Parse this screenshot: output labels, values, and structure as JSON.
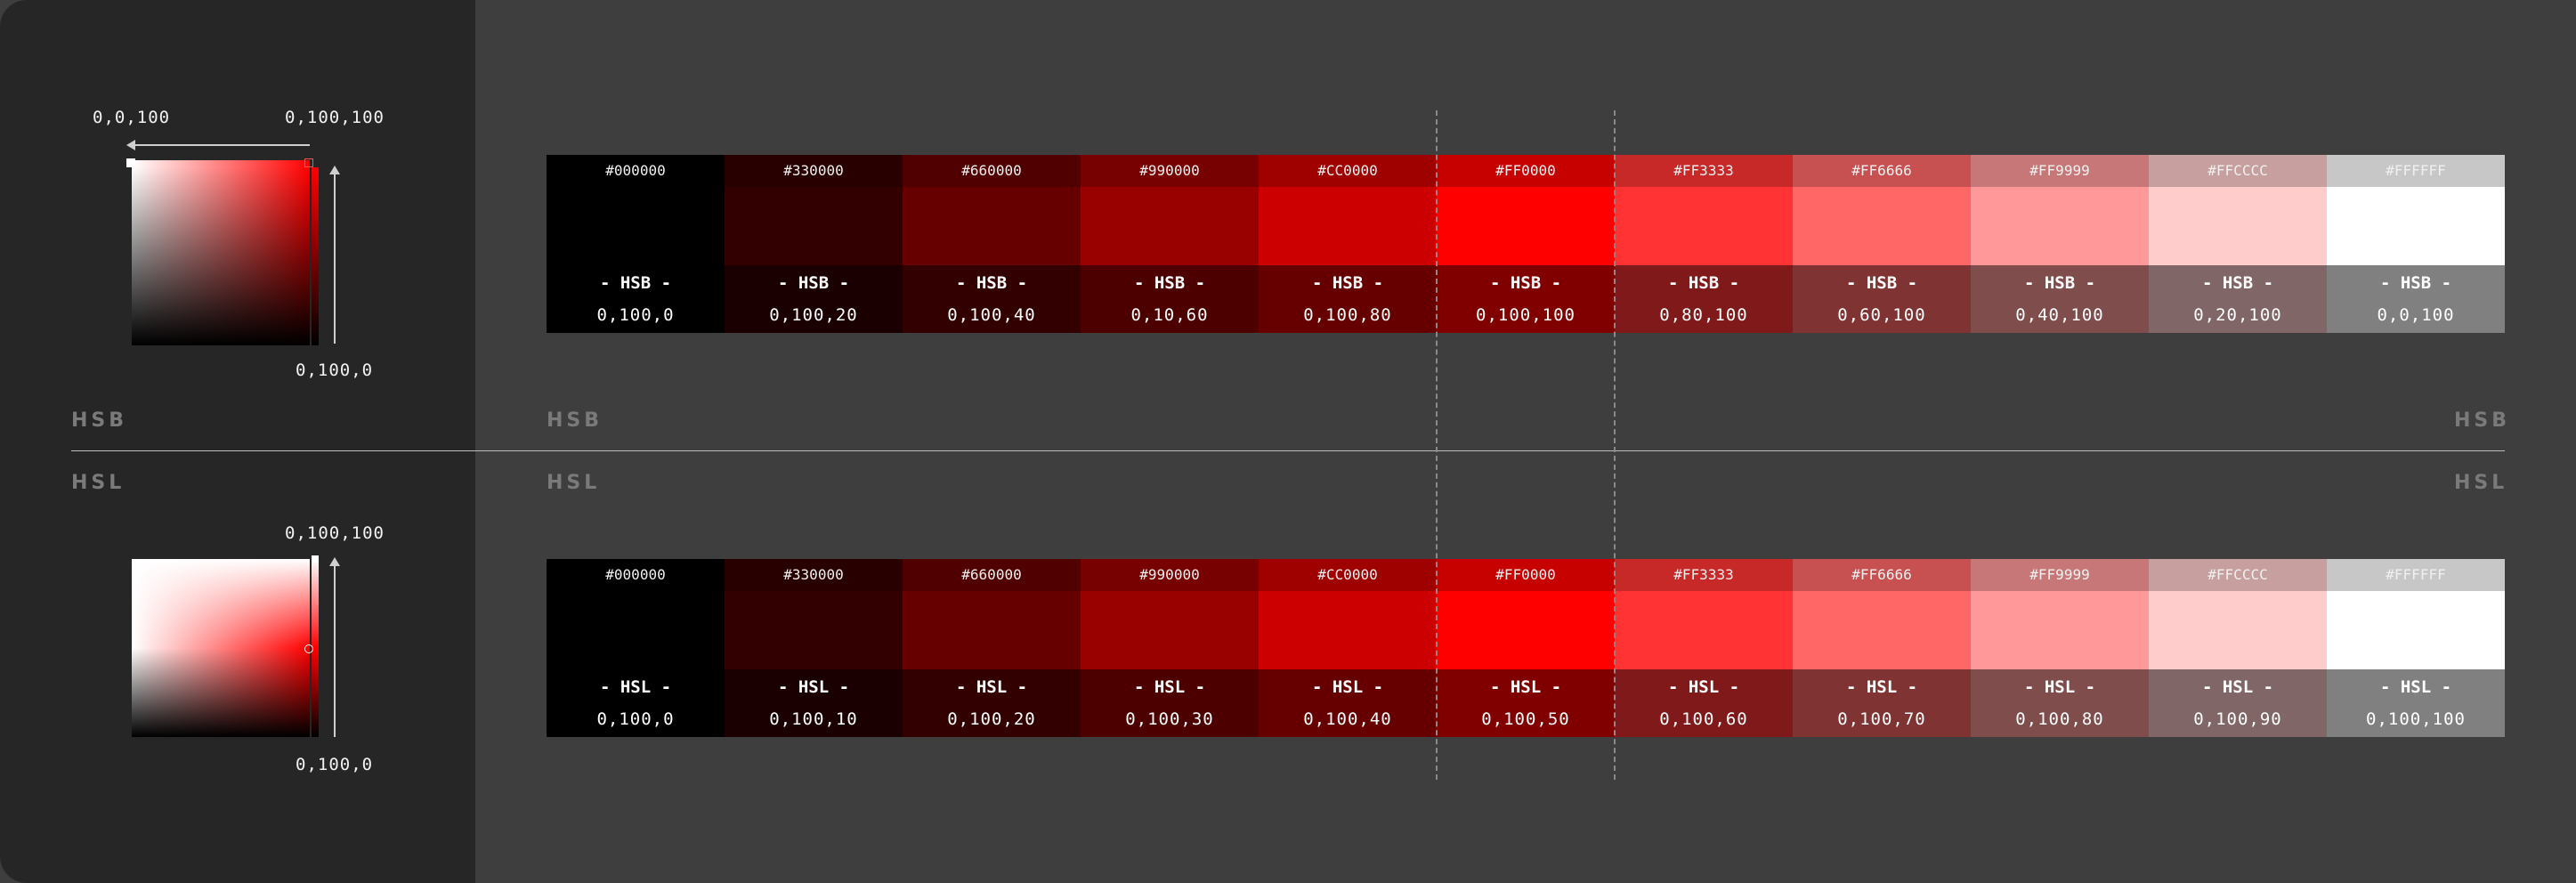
{
  "hsb_section": {
    "left_label": "HSB",
    "strip_label": "HSB",
    "right_label": "HSB",
    "picker_top_left": "0,0,100",
    "picker_top_right": "0,100,100",
    "picker_bottom_right": "0,100,0",
    "cells": [
      {
        "hex": "#000000",
        "mode": "- HSB -",
        "value": "0,100,0",
        "swatch": "#000000",
        "band": "#000000"
      },
      {
        "hex": "#330000",
        "mode": "- HSB -",
        "value": "0,100,20",
        "swatch": "#330000",
        "band": "#1a0000"
      },
      {
        "hex": "#660000",
        "mode": "- HSB -",
        "value": "0,100,40",
        "swatch": "#660000",
        "band": "#330000"
      },
      {
        "hex": "#990000",
        "mode": "- HSB -",
        "value": "0,10,60",
        "swatch": "#990000",
        "band": "#4d0000"
      },
      {
        "hex": "#CC0000",
        "mode": "- HSB -",
        "value": "0,100,80",
        "swatch": "#cc0000",
        "band": "#660000"
      },
      {
        "hex": "#FF0000",
        "mode": "- HSB -",
        "value": "0,100,100",
        "swatch": "#ff0000",
        "band": "#800000"
      },
      {
        "hex": "#FF3333",
        "mode": "- HSB -",
        "value": "0,80,100",
        "swatch": "#ff3333",
        "band": "#801a1a"
      },
      {
        "hex": "#FF6666",
        "mode": "- HSB -",
        "value": "0,60,100",
        "swatch": "#ff6666",
        "band": "#803333"
      },
      {
        "hex": "#FF9999",
        "mode": "- HSB -",
        "value": "0,40,100",
        "swatch": "#ff9999",
        "band": "#804d4d"
      },
      {
        "hex": "#FFCCCC",
        "mode": "- HSB -",
        "value": "0,20,100",
        "swatch": "#ffcccc",
        "band": "#806666"
      },
      {
        "hex": "#FFFFFF",
        "mode": "- HSB -",
        "value": "0,0,100",
        "swatch": "#ffffff",
        "band": "#808080"
      }
    ]
  },
  "hsl_section": {
    "left_label": "HSL",
    "strip_label": "HSL",
    "right_label": "HSL",
    "picker_top_right": "0,100,100",
    "picker_bottom_right": "0,100,0",
    "cells": [
      {
        "hex": "#000000",
        "mode": "- HSL -",
        "value": "0,100,0",
        "swatch": "#000000",
        "band": "#000000"
      },
      {
        "hex": "#330000",
        "mode": "- HSL -",
        "value": "0,100,10",
        "swatch": "#330000",
        "band": "#1a0000"
      },
      {
        "hex": "#660000",
        "mode": "- HSL -",
        "value": "0,100,20",
        "swatch": "#660000",
        "band": "#330000"
      },
      {
        "hex": "#990000",
        "mode": "- HSL -",
        "value": "0,100,30",
        "swatch": "#990000",
        "band": "#4d0000"
      },
      {
        "hex": "#CC0000",
        "mode": "- HSL -",
        "value": "0,100,40",
        "swatch": "#cc0000",
        "band": "#660000"
      },
      {
        "hex": "#FF0000",
        "mode": "- HSL -",
        "value": "0,100,50",
        "swatch": "#ff0000",
        "band": "#800000"
      },
      {
        "hex": "#FF3333",
        "mode": "- HSL -",
        "value": "0,100,60",
        "swatch": "#ff3333",
        "band": "#801a1a"
      },
      {
        "hex": "#FF6666",
        "mode": "- HSL -",
        "value": "0,100,70",
        "swatch": "#ff6666",
        "band": "#803333"
      },
      {
        "hex": "#FF9999",
        "mode": "- HSL -",
        "value": "0,100,80",
        "swatch": "#ff9999",
        "band": "#804d4d"
      },
      {
        "hex": "#FFCCCC",
        "mode": "- HSL -",
        "value": "0,100,90",
        "swatch": "#ffcccc",
        "band": "#806666"
      },
      {
        "hex": "#FFFFFF",
        "mode": "- HSL -",
        "value": "0,100,100",
        "swatch": "#ffffff",
        "band": "#808080"
      }
    ]
  }
}
